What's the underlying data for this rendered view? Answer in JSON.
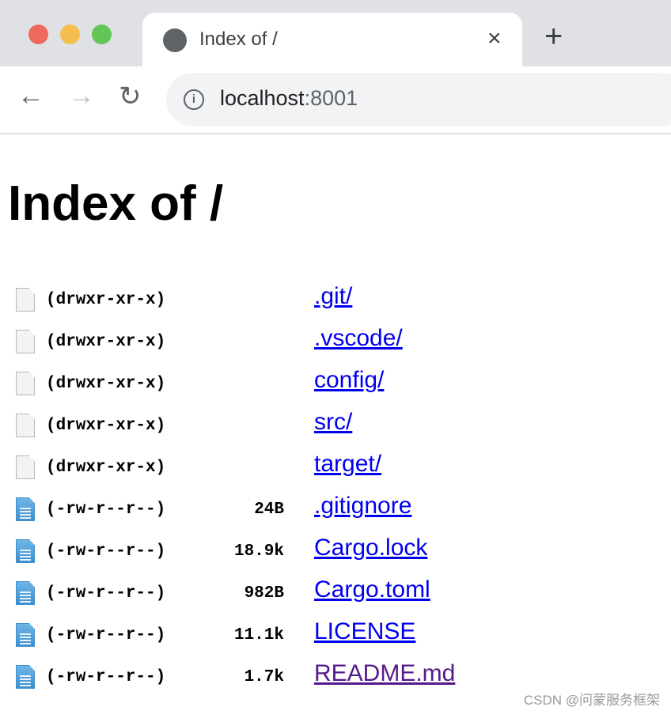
{
  "browser": {
    "tab_title": "Index of /",
    "tab_icon": "globe-icon",
    "close_label": "×",
    "new_tab_label": "+",
    "url_host": "localhost",
    "url_port": ":8001",
    "colors": {
      "close": "#ee6a5f",
      "minimize": "#f5be4f",
      "maximize": "#62c554"
    }
  },
  "page": {
    "title": "Index of /",
    "entries": [
      {
        "mode": "(drwxr-xr-x)",
        "size": "",
        "name": ".git/",
        "type": "folder"
      },
      {
        "mode": "(drwxr-xr-x)",
        "size": "",
        "name": ".vscode/",
        "type": "folder"
      },
      {
        "mode": "(drwxr-xr-x)",
        "size": "",
        "name": "config/",
        "type": "folder"
      },
      {
        "mode": "(drwxr-xr-x)",
        "size": "",
        "name": "src/",
        "type": "folder"
      },
      {
        "mode": "(drwxr-xr-x)",
        "size": "",
        "name": "target/",
        "type": "folder"
      },
      {
        "mode": "(-rw-r--r--)",
        "size": "24B",
        "name": ".gitignore",
        "type": "file"
      },
      {
        "mode": "(-rw-r--r--)",
        "size": "18.9k",
        "name": "Cargo.lock",
        "type": "file"
      },
      {
        "mode": "(-rw-r--r--)",
        "size": "982B",
        "name": "Cargo.toml",
        "type": "file"
      },
      {
        "mode": "(-rw-r--r--)",
        "size": "11.1k",
        "name": "LICENSE",
        "type": "file"
      },
      {
        "mode": "(-rw-r--r--)",
        "size": "1.7k",
        "name": "README.md",
        "type": "file",
        "visited": true
      }
    ]
  },
  "watermark": "CSDN @问蒙服务框架"
}
